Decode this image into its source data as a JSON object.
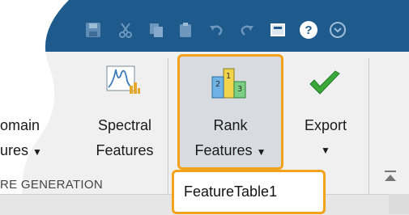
{
  "quick_access_toolbar": {
    "icons": [
      "save-icon",
      "cut-icon",
      "copy-icon",
      "paste-icon",
      "undo-icon",
      "redo-icon",
      "layout-icon",
      "help-icon",
      "options-icon"
    ],
    "help_glyph": "?"
  },
  "ribbon": {
    "time_domain": {
      "label_line1": "omain",
      "label_line2": "ures"
    },
    "spectral": {
      "label_line1": "Spectral",
      "label_line2": "Features"
    },
    "rank": {
      "label_line1": "Rank",
      "label_line2": "Features"
    },
    "export": {
      "label": "Export"
    },
    "section_label": "RE GENERATION"
  },
  "data_browser": {
    "item": "FeatureTable1"
  },
  "colors": {
    "titlebar": "#1f5a8c",
    "ribbon": "#f0f0f0",
    "highlight": "#f2a21b",
    "check": "#3aa83a"
  }
}
